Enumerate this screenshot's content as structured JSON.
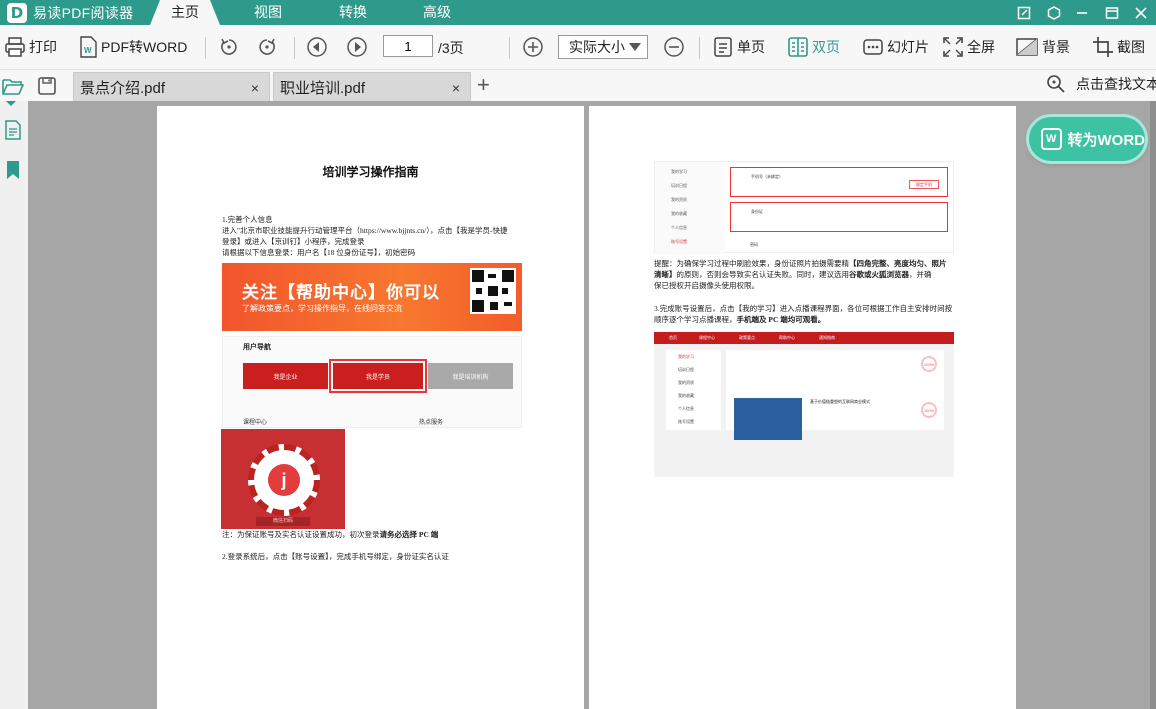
{
  "app": {
    "name": "易读PDF阅读器",
    "logo_glyph": "D"
  },
  "menu": {
    "tabs": [
      {
        "label": "主页",
        "active": true
      },
      {
        "label": "视图",
        "active": false
      },
      {
        "label": "转换",
        "active": false
      },
      {
        "label": "高级",
        "active": false
      }
    ]
  },
  "toolbar": {
    "print": "打印",
    "pdf_to_word": "PDF转WORD",
    "page_current": "1",
    "page_total": "/3页",
    "zoom": "实际大小",
    "single_page": "单页",
    "double_page": "双页",
    "slideshow": "幻灯片",
    "fullscreen": "全屏",
    "background": "背景",
    "screenshot": "截图"
  },
  "tabs": [
    {
      "title": "景点介绍.pdf",
      "close": "×"
    },
    {
      "title": "职业培训.pdf",
      "close": "×"
    }
  ],
  "find": "点击查找文本",
  "convert_button": "转为WORD",
  "convert_icon": "W",
  "colors": {
    "accent": "#2e9a8b",
    "title_bar": "#2e9a8b",
    "convert_button": "#3dc2a4",
    "warning_red": "#e02020"
  },
  "doc": {
    "left": {
      "title": "培训学习操作指南",
      "step1_head": "1.完善个人信息",
      "step1_line1": "进入\"北京市职业技能提升行动管理平台（https://www.bjjnts.cn/），点击【我是学员-快捷",
      "step1_line2": "登录】或进入【京训钉】小程序，完成登录",
      "step1_warn": "请根据以下信息登录：用户名【18 位身份证号】，初始密码",
      "banner_title": "关注【帮助中心】你可以",
      "banner_sub": "了解政策要点，学习操作指导，在线问答交流",
      "nav_title": "用户导航",
      "nav_cards": [
        "我是企业",
        "我是学员",
        "我是培训机构"
      ],
      "nav_bottom": "课程中心",
      "nav_bottom2": "热点服务",
      "mini_label": "微信扫码",
      "note_prefix": "注：为保证账号及实名认证设置成功，初次登录",
      "note_bold": "请务必选择 PC 端",
      "step2": "2.登录系统后，点击【账号设置】，完成手机号绑定，身份证实名认证"
    },
    "right": {
      "shot1_side": [
        "我的学习",
        "培训日程",
        "我的资质",
        "我的收藏",
        "个人信息",
        "账号设置"
      ],
      "shot1_phone": "手机号（未绑定）",
      "shot1_id": "身份证",
      "shot1_pwd": "密码",
      "shot1_btn": "绑定手机",
      "tip_l1a": "提醒：为确保学习过程中刷脸效果，身份证照片拍摄需要精",
      "tip_l1b": "【四角完整、亮度均匀、照片",
      "tip_l2a": "清晰】",
      "tip_l2b": "的原则，否则会导致实名认证失败。同时，建议选用",
      "tip_l2c": "谷歌或火狐浏览器",
      "tip_l2d": "，并确",
      "tip_l3": "保已授权开启摄像头使用权限。",
      "step3_l1": "3.完成账号设置后，点击【我的学习】进入点播课程界面，各位可根据工作自主安排时间按",
      "step3_l2a": "顺序逐个学习点播课程，",
      "step3_l2b": "手机端及 PC 端均可观看。",
      "shot2_nav": [
        "首页",
        "课程中心",
        "政策要点",
        "帮助中心",
        "通知指南"
      ],
      "shot2_side": [
        "我的学习",
        "培训日程",
        "我的资质",
        "我的收藏",
        "个人信息",
        "账号设置"
      ],
      "shot2_pct": "100%",
      "shot2_course": "基于价值链重塑的互联网商业模式"
    }
  }
}
